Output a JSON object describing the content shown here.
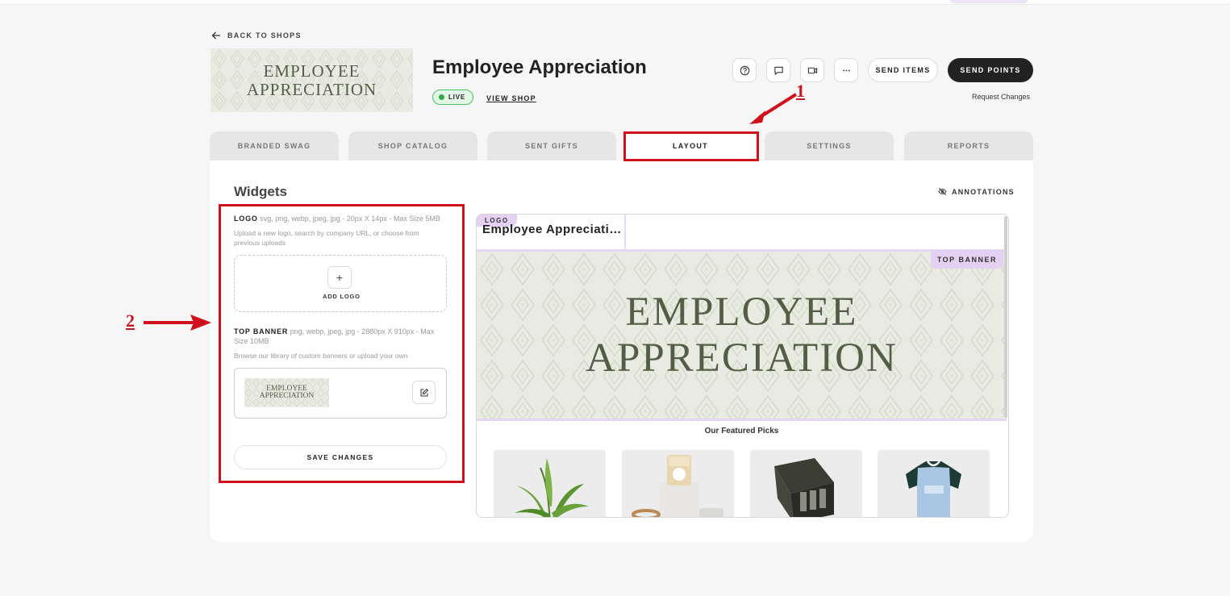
{
  "nav": {
    "back_label": "BACK TO SHOPS"
  },
  "shop": {
    "title": "Employee Appreciation",
    "status": "LIVE",
    "view_shop_label": "VIEW SHOP",
    "banner_text_line1": "EMPLOYEE",
    "banner_text_line2": "APPRECIATION"
  },
  "actions": {
    "icons": [
      "help-icon",
      "chat-icon",
      "video-icon",
      "more-icon"
    ],
    "send_items": "SEND ITEMS",
    "send_points": "SEND POINTS",
    "request_changes": "Request Changes"
  },
  "tabs": [
    {
      "label": "BRANDED SWAG"
    },
    {
      "label": "SHOP CATALOG"
    },
    {
      "label": "SENT GIFTS"
    },
    {
      "label": "LAYOUT",
      "active": true
    },
    {
      "label": "SETTINGS"
    },
    {
      "label": "REPORTS"
    }
  ],
  "widgets": {
    "title": "Widgets",
    "annotations_label": "ANNOTATIONS",
    "logo": {
      "label": "LOGO",
      "spec": "svg, png, webp, jpeg, jpg - 20px X 14px - Max Size 5MB",
      "hint": "Upload a new logo, search by company URL, or choose from previous uploads",
      "add_label": "ADD LOGO"
    },
    "top_banner": {
      "label": "TOP BANNER",
      "spec": "png, webp, jpeg, jpg - 2880px X 910px - Max Size 10MB",
      "hint": "Browse our library of custom banners or upload your own"
    },
    "save_label": "SAVE CHANGES"
  },
  "preview": {
    "logo_tag": "LOGO",
    "logo_name": "Employee Appreciation",
    "banner_tag": "TOP BANNER",
    "featured_title": "Our Featured Picks",
    "products": [
      "plant",
      "candle",
      "gift-box",
      "jersey"
    ]
  },
  "annotations_overlay": {
    "callout_1": "1",
    "callout_2": "2"
  },
  "colors": {
    "accent": "#222222",
    "live_green": "#4cbf63",
    "annotation_red": "#d0101a",
    "tag_lilac": "#e4d0f3"
  }
}
